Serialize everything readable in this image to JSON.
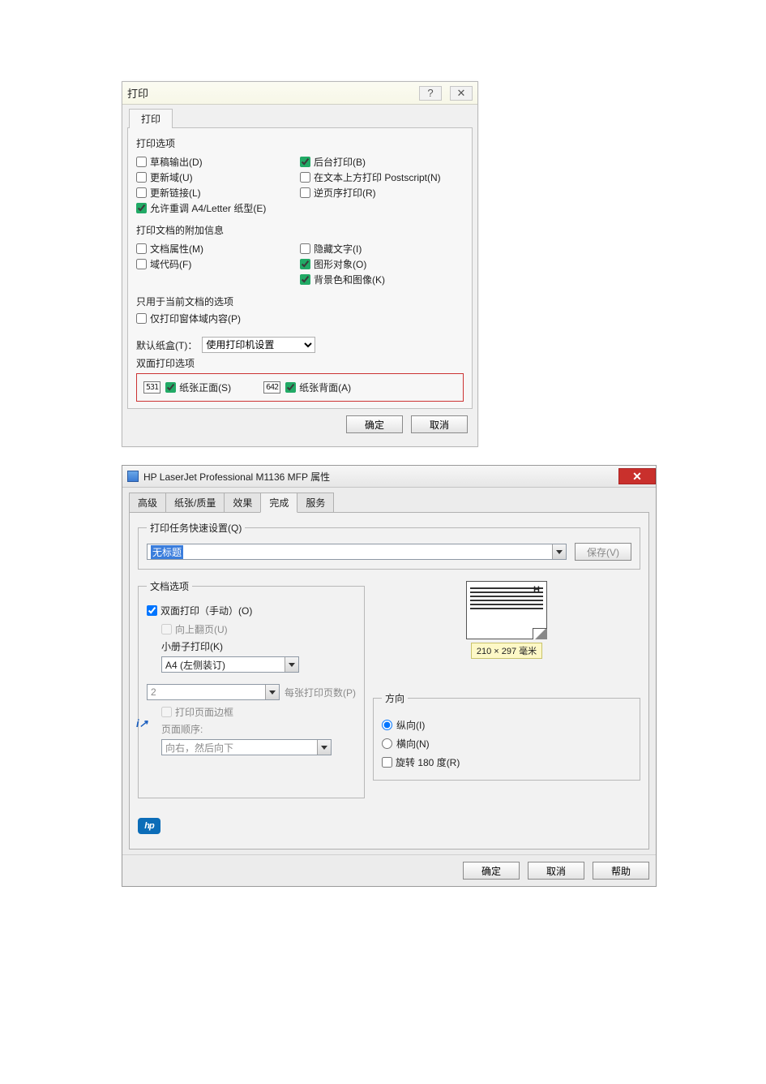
{
  "dlg1": {
    "title": "打印",
    "help_char": "?",
    "close_char": "✕",
    "tab_label": "打印",
    "print_options_label": "打印选项",
    "left_opts": [
      {
        "label": "草稿输出(D)",
        "checked": false
      },
      {
        "label": "更新域(U)",
        "checked": false
      },
      {
        "label": "更新链接(L)",
        "checked": false
      },
      {
        "label": "允许重调 A4/Letter 纸型(E)",
        "checked": true
      }
    ],
    "right_opts": [
      {
        "label": "后台打印(B)",
        "checked": true
      },
      {
        "label": "在文本上方打印 Postscript(N)",
        "checked": false
      },
      {
        "label": "逆页序打印(R)",
        "checked": false
      }
    ],
    "attach_label": "打印文档的附加信息",
    "attach_left": [
      {
        "label": "文档属性(M)",
        "checked": false
      },
      {
        "label": "域代码(F)",
        "checked": false
      }
    ],
    "attach_right": [
      {
        "label": "隐藏文字(I)",
        "checked": false
      },
      {
        "label": "图形对象(O)",
        "checked": true
      },
      {
        "label": "背景色和图像(K)",
        "checked": true
      }
    ],
    "cur_doc_label": "只用于当前文档的选项",
    "cur_doc_opts": [
      {
        "label": "仅打印窗体域内容(P)",
        "checked": false
      }
    ],
    "tray_label": "默认纸盒(T)：",
    "tray_value": "使用打印机设置",
    "duplex_label": "双面打印选项",
    "duplex_front_icon": "531",
    "duplex_front": {
      "label": "纸张正面(S)",
      "checked": true
    },
    "duplex_back_icon": "642",
    "duplex_back": {
      "label": "纸张背面(A)",
      "checked": true
    },
    "ok": "确定",
    "cancel": "取消"
  },
  "dlg2": {
    "title": "HP LaserJet Professional M1136 MFP 属性",
    "close_char": "✕",
    "tabs": [
      "高级",
      "纸张/质量",
      "效果",
      "完成",
      "服务"
    ],
    "active_tab_index": 3,
    "quickset_legend": "打印任务快速设置(Q)",
    "quickset_value": "无标题",
    "save": "保存(V)",
    "docopt_legend": "文档选项",
    "manual_duplex": {
      "label": "双面打印（手动）(O)",
      "checked": true
    },
    "flip_up": {
      "label": "向上翻页(U)",
      "checked": false
    },
    "booklet_label": "小册子打印(K)",
    "booklet_value": "A4 (左侧装订)",
    "pages_per_sheet_value": "2",
    "pages_per_sheet_label": "每张打印页数(P)",
    "page_border": {
      "label": "打印页面边框",
      "checked": false
    },
    "page_order_label": "页面顺序:",
    "page_order_value": "向右，然后向下",
    "preview_size": "210 × 297 毫米",
    "orientation_legend": "方向",
    "portrait": "纵向(I)",
    "landscape": "横向(N)",
    "rotate180": {
      "label": "旋转 180 度(R)",
      "checked": false
    },
    "hp_logo_text": "hp",
    "ok": "确定",
    "cancel": "取消",
    "help": "帮助"
  }
}
